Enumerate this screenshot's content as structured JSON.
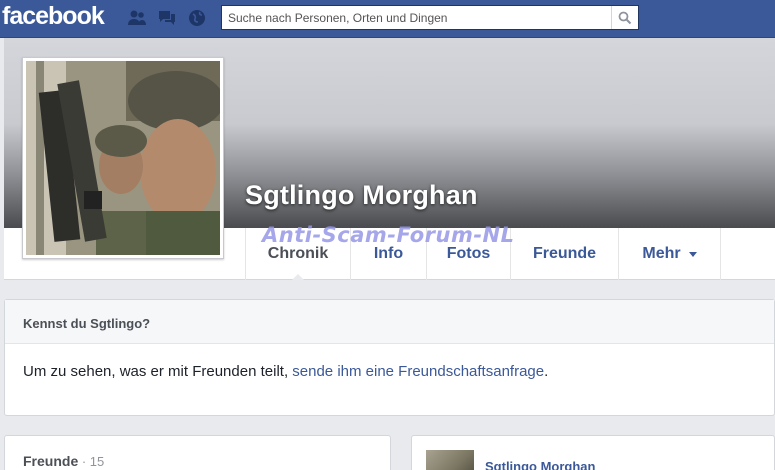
{
  "topbar": {
    "logo": "facebook",
    "search_placeholder": "Suche nach Personen, Orten und Dingen",
    "icons": [
      "friend-requests-icon",
      "messages-icon",
      "notifications-globe-icon",
      "search-icon"
    ]
  },
  "profile": {
    "name": "Sgtlingo Morghan",
    "watermark": "Anti-Scam-Forum-NL"
  },
  "tabs": [
    {
      "label": "Chronik",
      "active": true
    },
    {
      "label": "Info",
      "active": false
    },
    {
      "label": "Fotos",
      "active": false
    },
    {
      "label": "Freunde",
      "active": false
    },
    {
      "label": "Mehr",
      "active": false
    }
  ],
  "know_panel": {
    "title": "Kennst du Sgtlingo?",
    "text_before": "Um zu sehen, was er mit Freunden teilt, ",
    "link": "sende ihm eine Freundschaftsanfrage",
    "text_after": "."
  },
  "friends_panel": {
    "label": "Freunde",
    "separator": " · ",
    "count": "15"
  },
  "post": {
    "author": "Sgtlingo Morghan"
  },
  "colors": {
    "brand_blue": "#3b5998",
    "background": "#e9eaed"
  }
}
